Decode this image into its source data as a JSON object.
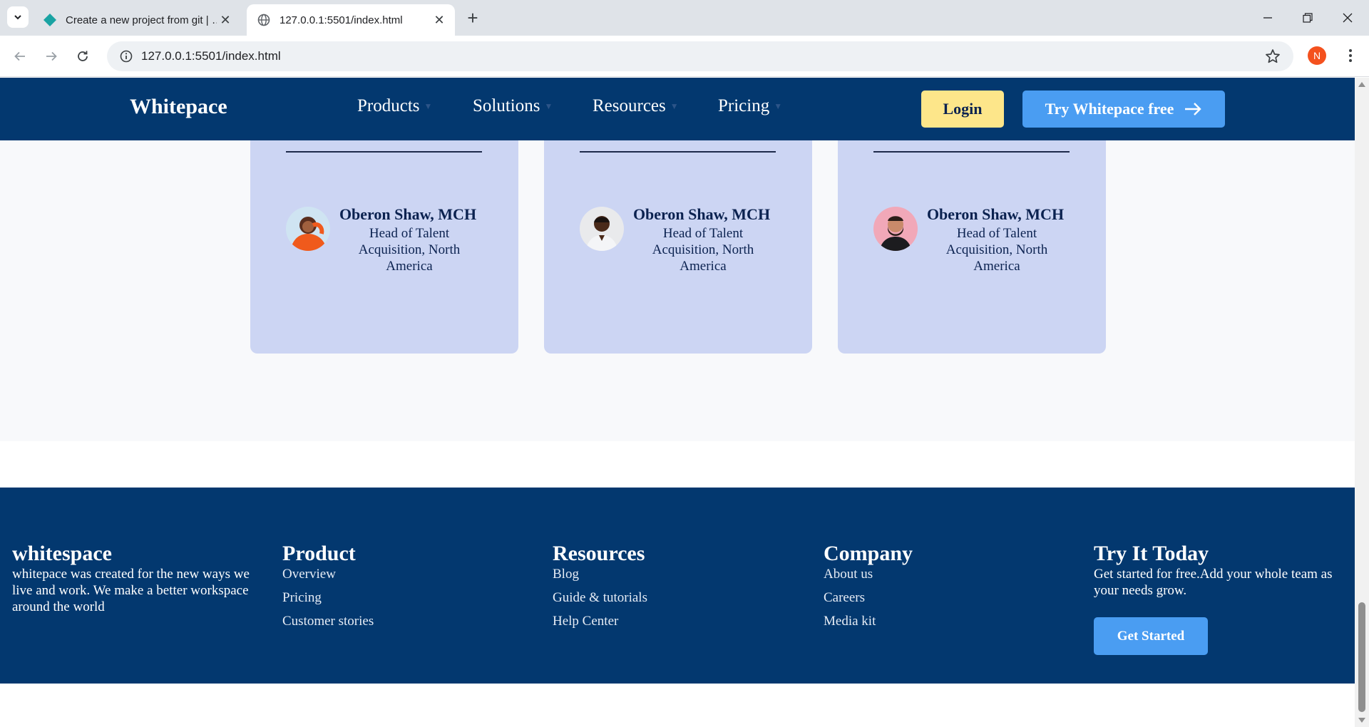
{
  "browser": {
    "tabs": [
      {
        "title": "Create a new project from git | …",
        "active": false,
        "favicon": "diamond-icon"
      },
      {
        "title": "127.0.0.1:5501/index.html",
        "active": true,
        "favicon": "globe-icon"
      }
    ],
    "address": "127.0.0.1:5501/index.html",
    "profile_initial": "N",
    "profile_color": "#f4511e"
  },
  "header": {
    "brand": "Whitepace",
    "nav": [
      {
        "label": "Products"
      },
      {
        "label": "Solutions"
      },
      {
        "label": "Resources"
      },
      {
        "label": "Pricing"
      }
    ],
    "login_label": "Login",
    "try_label": "Try Whitepace free",
    "colors": {
      "header_bg": "#03386f",
      "login_bg": "#fde68a",
      "try_bg": "#4a9df2"
    }
  },
  "testimonials": {
    "cards": [
      {
        "name": "Oberon Shaw, MCH",
        "role": "Head of Talent Acquisition, North America",
        "avatar": "woman-orange-avatar"
      },
      {
        "name": "Oberon Shaw, MCH",
        "role": "Head of Talent Acquisition, North America",
        "avatar": "man-white-shirt-avatar"
      },
      {
        "name": "Oberon Shaw, MCH",
        "role": "Head of Talent Acquisition, North America",
        "avatar": "man-pink-bg-avatar"
      }
    ],
    "card_color": "#ccd5f3"
  },
  "footer": {
    "about": {
      "title": "whitespace",
      "text": "whitepace was created for the new ways we live and work. We make a better workspace around the world"
    },
    "product": {
      "title": "Product",
      "links": [
        "Overview",
        "Pricing",
        "Customer stories"
      ]
    },
    "resources": {
      "title": "Resources",
      "links": [
        "Blog",
        "Guide & tutorials",
        "Help Center"
      ]
    },
    "company": {
      "title": "Company",
      "links": [
        "About us",
        "Careers",
        "Media kit"
      ]
    },
    "try": {
      "title": "Try It Today",
      "text": "Get started for free.Add your whole team as your needs grow.",
      "button": "Get Started"
    }
  }
}
